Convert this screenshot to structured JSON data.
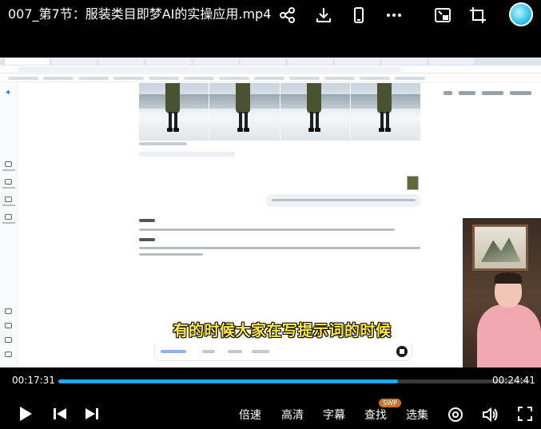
{
  "video": {
    "title": "007_第7节：服装类目即梦AI的实操应用.mp4",
    "current_time": "00:17:31",
    "total_time": "00:24:41",
    "progress_fraction": 0.72,
    "subtitle": "有的时候大家在写提示词的时候"
  },
  "top_icons": [
    "share-icon",
    "download-icon",
    "phone-icon",
    "more-icon",
    "pip-icon",
    "crop-icon",
    "avatar-icon"
  ],
  "controls": {
    "speed_label": "倍速",
    "quality_label": "高清",
    "subtitles_label": "字幕",
    "search_label": "查找",
    "search_badge": "SWP",
    "episodes_label": "选集"
  },
  "colors": {
    "progress": "#27a3f5",
    "subtitle_text": "#ffe94d",
    "badge": "#c8732b"
  }
}
